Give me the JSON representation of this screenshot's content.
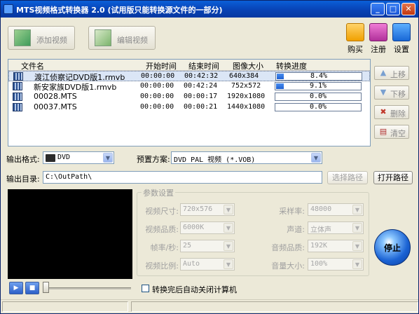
{
  "window": {
    "title": "MTS视频格式转换器 2.0 (试用版只能转换源文件的一部分)"
  },
  "toolbar": {
    "add_video": "添加视频",
    "edit_video": "编辑视频",
    "buy": "购买",
    "register": "注册",
    "settings": "设置"
  },
  "file_list": {
    "columns": [
      "文件名",
      "开始时间",
      "结束时间",
      "图像大小",
      "转换进度"
    ],
    "rows": [
      {
        "name": "渡江侦察记DVD版1.rmvb",
        "start": "00:00:00",
        "end": "00:42:32",
        "size": "640x384",
        "progress_text": "8.4%",
        "progress": 0.084,
        "selected": true
      },
      {
        "name": "新安家族DVD版1.rmvb",
        "start": "00:00:00",
        "end": "00:42:24",
        "size": "752x572",
        "progress_text": "9.1%",
        "progress": 0.091,
        "selected": false
      },
      {
        "name": "00028.MTS",
        "start": "00:00:00",
        "end": "00:00:17",
        "size": "1920x1080",
        "progress_text": "0.0%",
        "progress": 0,
        "selected": false
      },
      {
        "name": "00037.MTS",
        "start": "00:00:00",
        "end": "00:00:21",
        "size": "1440x1080",
        "progress_text": "0.0%",
        "progress": 0,
        "selected": false
      }
    ]
  },
  "side_buttons": {
    "up": "上移",
    "down": "下移",
    "delete": "删除",
    "clear": "清空"
  },
  "output": {
    "format_label": "输出格式:",
    "format_value": "DVD",
    "preset_label": "预置方案:",
    "preset_value": "DVD PAL 视频  (*.VOB)",
    "dir_label": "输出目录:",
    "dir_value": "C:\\OutPath\\",
    "browse_button": "选择路径",
    "open_button": "打开路径"
  },
  "params": {
    "group_title": "参数设置",
    "video_size_label": "视频尺寸:",
    "video_size_value": "720x576",
    "video_quality_label": "视频品质:",
    "video_quality_value": "6000K",
    "frame_rate_label": "帧率/秒:",
    "frame_rate_value": "25",
    "aspect_label": "视频比例:",
    "aspect_value": "Auto",
    "sample_rate_label": "采样率:",
    "sample_rate_value": "48000",
    "channel_label": "声道:",
    "channel_value": "立体声",
    "audio_quality_label": "音频品质:",
    "audio_quality_value": "192K",
    "volume_label": "音量大小:",
    "volume_value": "100%"
  },
  "player": {
    "play_icon": "play-icon",
    "stop_icon": "stop-icon"
  },
  "auto_shutdown_label": "转换完后自动关闭计算机",
  "stop_button": "停止",
  "colors": {
    "titlebar": "#0842b5",
    "progress": "#1d5fd0",
    "selection": "#dbe6f6"
  }
}
